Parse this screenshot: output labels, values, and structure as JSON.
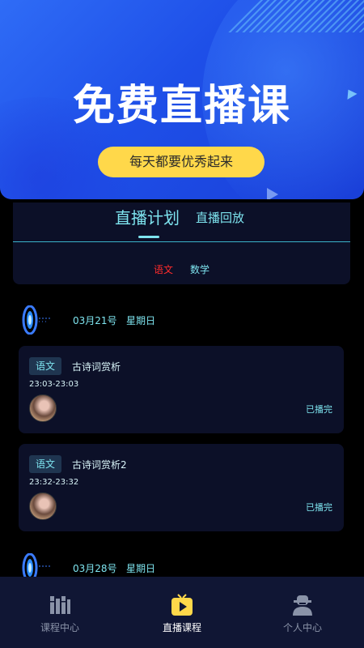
{
  "hero": {
    "title": "免费直播课",
    "button_label": "每天都要优秀起来"
  },
  "plan": {
    "tab_active": "直播计划",
    "tab_other": "直播回放",
    "subjects": [
      {
        "label": "语文",
        "selected": true
      },
      {
        "label": "数学",
        "selected": false
      }
    ]
  },
  "schedule": [
    {
      "date": "03月21号",
      "weekday": "星期日"
    },
    {
      "date": "03月28号",
      "weekday": "星期日"
    }
  ],
  "cards": [
    {
      "tag": "语文",
      "title": "古诗词赏析",
      "time": "23:03-23:03",
      "status": "已播完"
    },
    {
      "tag": "语文",
      "title": "古诗词赏析2",
      "time": "23:32-23:32",
      "status": "已播完"
    }
  ],
  "tabbar": [
    {
      "label": "课程中心",
      "icon": "books-icon",
      "active": false
    },
    {
      "label": "直播课程",
      "icon": "tv-play-icon",
      "active": true
    },
    {
      "label": "个人中心",
      "icon": "user-icon",
      "active": false
    }
  ],
  "colors": {
    "accent": "#7ee4ef",
    "hero_blue": "#1e4fe8",
    "button_yellow": "#ffd84a",
    "selected_subject": "#ff2b2b",
    "card_bg": "#0c1028"
  }
}
